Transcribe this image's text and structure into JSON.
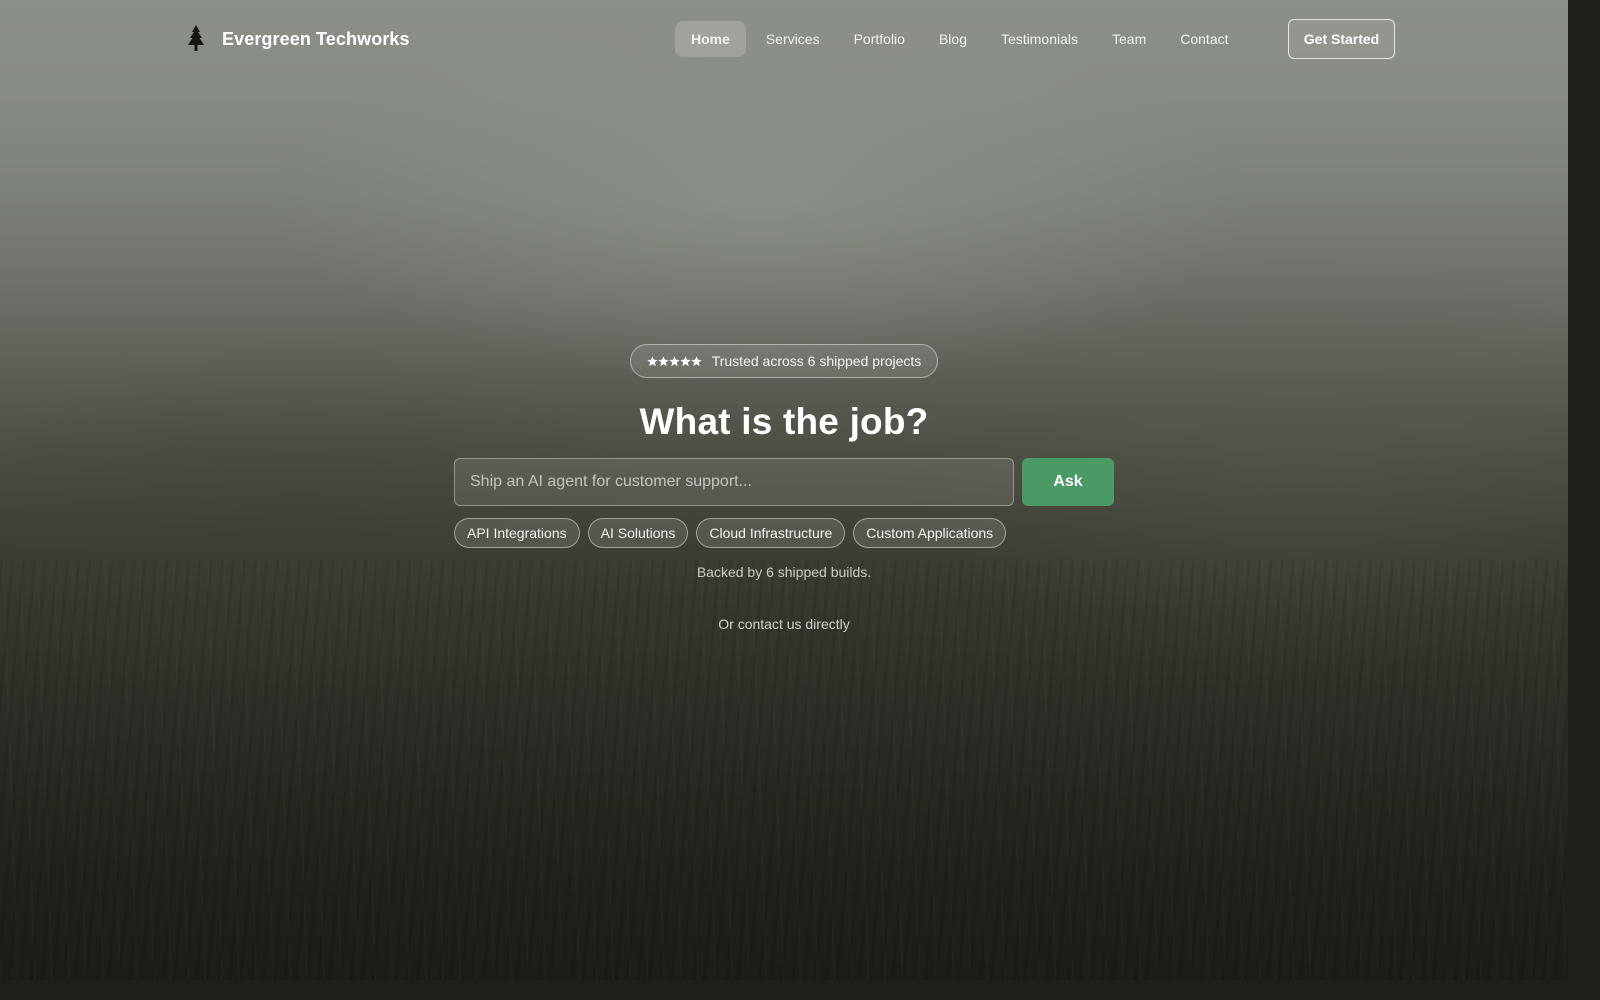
{
  "brand": {
    "name": "Evergreen Techworks",
    "logo_icon": "evergreen-tree-icon"
  },
  "nav": {
    "links": [
      {
        "label": "Home",
        "active": true
      },
      {
        "label": "Services",
        "active": false
      },
      {
        "label": "Portfolio",
        "active": false
      },
      {
        "label": "Blog",
        "active": false
      },
      {
        "label": "Testimonials",
        "active": false
      },
      {
        "label": "Team",
        "active": false
      },
      {
        "label": "Contact",
        "active": false
      }
    ],
    "cta_label": "Get Started"
  },
  "hero": {
    "trust_badge": {
      "stars": 5,
      "text": "Trusted across 6 shipped projects"
    },
    "headline": "What is the job?",
    "search": {
      "placeholder": "Ship an AI agent for customer support...",
      "value": ""
    },
    "ask_label": "Ask",
    "chips": [
      "API Integrations",
      "AI Solutions",
      "Cloud Infrastructure",
      "Custom Applications"
    ],
    "backed_text": "Backed by 6 shipped builds.",
    "contact_text": "Or contact us directly"
  },
  "colors": {
    "accent": "#4a9a64",
    "text": "#ffffff"
  }
}
